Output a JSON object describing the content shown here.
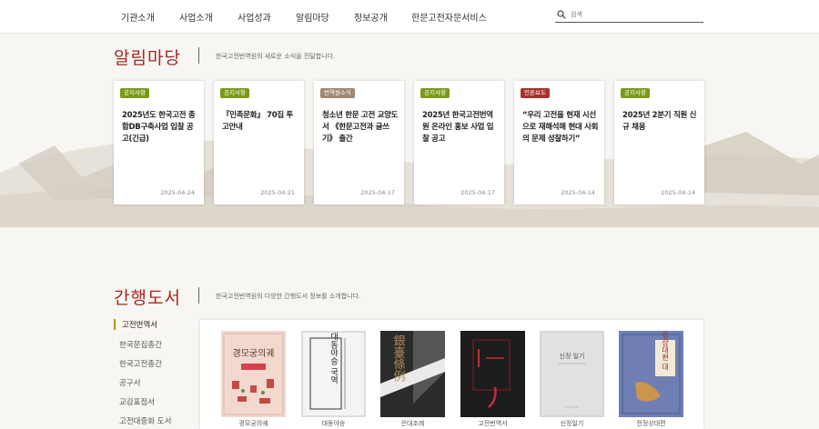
{
  "nav": {
    "items": [
      "기관소개",
      "사업소개",
      "사업성과",
      "알림마당",
      "정보공개",
      "한문고전자문서비스"
    ],
    "search_placeholder": "검색"
  },
  "notice": {
    "title": "알림마당",
    "description": "한국고전번역원의 새로운 소식을 전달합니다.",
    "cards": [
      {
        "badge": "공지사항",
        "badge_color": "#7a9a14",
        "title": "2025년도 한국고전 종합DB구축사업 입찰 공고(긴급)",
        "date": "2025-04-24"
      },
      {
        "badge": "공지사항",
        "badge_color": "#7a9a14",
        "title": "『민족문화』 70집 투고안내",
        "date": "2025-04-21"
      },
      {
        "badge": "번역원소식",
        "badge_color": "#a08875",
        "title": "청소년 한문 고전 교양도서 《한문고전과 글쓰기》 출간",
        "date": "2025-04-17"
      },
      {
        "badge": "공지사항",
        "badge_color": "#7a9a14",
        "title": "2025년 한국고전번역원 온라인 홍보 사업 입찰 공고",
        "date": "2025-04-17"
      },
      {
        "badge": "언론보도",
        "badge_color": "#a8322b",
        "title": "“우리 고전을 현재 시선으로 재해석해 현대 사회의 문제 성찰하기”",
        "date": "2025-04-14"
      },
      {
        "badge": "공지사항",
        "badge_color": "#7a9a14",
        "title": "2025년 2분기 직원 신규 채용",
        "date": "2025-04-14"
      }
    ]
  },
  "books": {
    "title": "간행도서",
    "description": "한국고전번역원의 다양한 간행도서 정보를 소개합니다.",
    "categories": [
      "고전번역서",
      "한국문집총간",
      "한국고전총간",
      "공구서",
      "교감표점서",
      "고전대중화 도서"
    ],
    "items": [
      {
        "cover_text": "경모궁의궤",
        "label": "경모궁의궤",
        "color": "#f1d9cf"
      },
      {
        "cover_text": "대동야승 국역",
        "label": "대동야승",
        "color": "#f4f4f4"
      },
      {
        "cover_text": "銀臺條例",
        "label": "은대조례",
        "color": "#2b2b2b"
      },
      {
        "cover_text": "",
        "label": "고전번역서",
        "color": "#1d1d1d"
      },
      {
        "cover_text": "신정 일기",
        "label": "신정일기",
        "color": "#e1e1e1"
      },
      {
        "cover_text": "전정상대편 대",
        "label": "전정상대편",
        "color": "#6f7fb4"
      }
    ]
  }
}
